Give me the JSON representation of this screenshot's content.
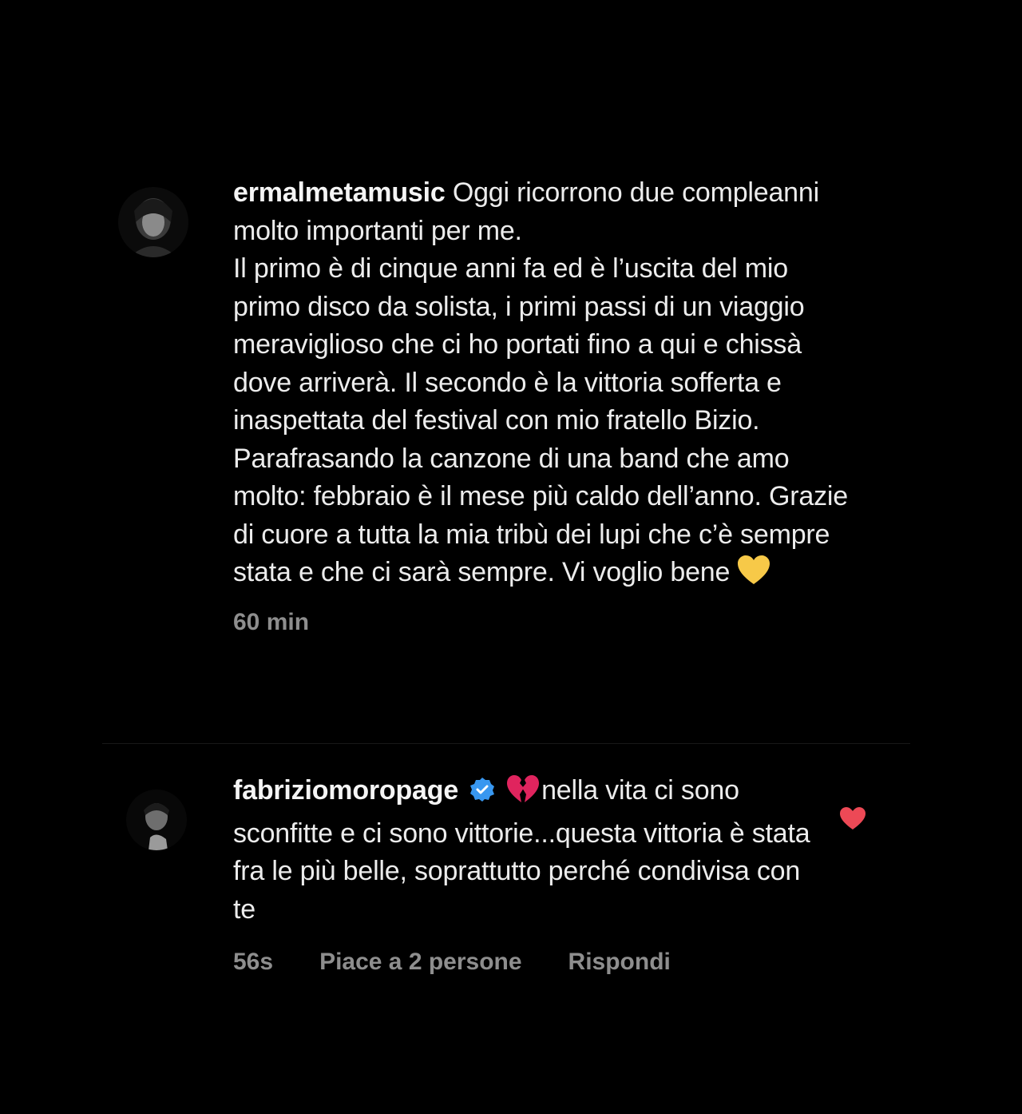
{
  "post_caption": {
    "username": "ermalmetamusic",
    "text": "Oggi ricorrono due compleanni molto importanti per me.",
    "text_line2": "Il primo è di cinque anni fa ed è l’uscita del mio primo disco da solista, i primi passi di un viaggio meraviglioso che ci ho portati fino a qui e chissà dove arriverà. Il secondo è la vittoria sofferta e inaspettata del festival con mio fratello Bizio. Parafrasando la canzone di una band che amo molto: febbraio è il mese più caldo dell’anno. Grazie di cuore a tutta la mia tribù dei lupi che c’è sempre stata e che ci sarà sempre. Vi voglio bene",
    "emoji": "yellow-heart-icon",
    "time": "60 min"
  },
  "reply": {
    "username": "fabriziomoropage",
    "verified": true,
    "emoji": "broken-heart-icon",
    "text": "nella vita ci sono sconfitte e ci sono vittorie...questa vittoria è stata fra le più belle, soprattutto perché condivisa con te",
    "time": "56s",
    "likes_label": "Piace a 2 persone",
    "reply_label": "Rispondi",
    "liked": true
  },
  "colors": {
    "background": "#000000",
    "text": "#ececec",
    "meta": "#8e8e8e",
    "verified_blue": "#3897f0",
    "like_red": "#ed4956",
    "yellow_heart": "#f7c948",
    "broken_heart": "#e0245e"
  }
}
